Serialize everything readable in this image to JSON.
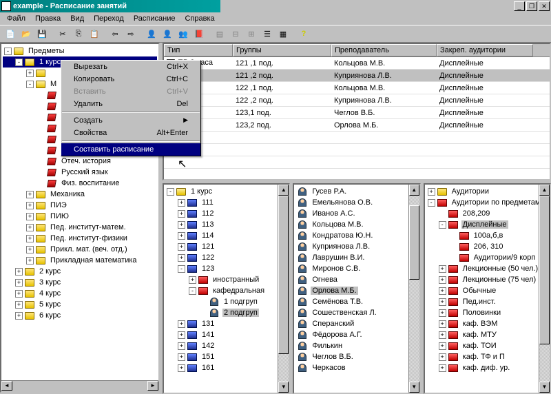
{
  "window": {
    "title": "example - Расписание занятий"
  },
  "menu": [
    "Файл",
    "Правка",
    "Вид",
    "Переход",
    "Расписание",
    "Справка"
  ],
  "ctx": {
    "items": [
      {
        "label": "Вырезать",
        "short": "Ctrl+X",
        "disabled": false
      },
      {
        "label": "Копировать",
        "short": "Ctrl+C",
        "disabled": false
      },
      {
        "label": "Вставить",
        "short": "Ctrl+V",
        "disabled": true
      },
      {
        "label": "Удалить",
        "short": "Del",
        "disabled": false
      },
      {
        "sep": true
      },
      {
        "label": "Создать",
        "submenu": true,
        "disabled": false
      },
      {
        "label": "Свойства",
        "short": "Alt+Enter",
        "disabled": false
      },
      {
        "sep": true
      },
      {
        "label": "Составить расписание",
        "highlight": true,
        "disabled": false
      }
    ]
  },
  "left_tree": [
    {
      "d": 0,
      "exp": "-",
      "ico": "folder-open",
      "t": "Предметы"
    },
    {
      "d": 1,
      "exp": "-",
      "ico": "folder-open",
      "t": "1 курс",
      "sel": true
    },
    {
      "d": 2,
      "exp": "+",
      "ico": "folder-closed",
      "t": ""
    },
    {
      "d": 2,
      "exp": "-",
      "ico": "folder-open",
      "t": "М"
    },
    {
      "d": 3,
      "exp": "",
      "ico": "book",
      "t": ""
    },
    {
      "d": 3,
      "exp": "",
      "ico": "book",
      "t": ""
    },
    {
      "d": 3,
      "exp": "",
      "ico": "book",
      "t": ""
    },
    {
      "d": 3,
      "exp": "",
      "ico": "book",
      "t": ""
    },
    {
      "d": 3,
      "exp": "",
      "ico": "book",
      "t": ""
    },
    {
      "d": 3,
      "exp": "",
      "ico": "book",
      "t": ""
    },
    {
      "d": 3,
      "exp": "",
      "ico": "book",
      "t": "Отеч. история"
    },
    {
      "d": 3,
      "exp": "",
      "ico": "book",
      "t": "Русский язык"
    },
    {
      "d": 3,
      "exp": "",
      "ico": "book",
      "t": "Физ. воспитание"
    },
    {
      "d": 2,
      "exp": "+",
      "ico": "folder-closed",
      "t": "Механика"
    },
    {
      "d": 2,
      "exp": "+",
      "ico": "folder-closed",
      "t": "ПИЭ"
    },
    {
      "d": 2,
      "exp": "+",
      "ico": "folder-closed",
      "t": "ПИЮ"
    },
    {
      "d": 2,
      "exp": "+",
      "ico": "folder-closed",
      "t": "Пед. институт-матем."
    },
    {
      "d": 2,
      "exp": "+",
      "ico": "folder-closed",
      "t": "Пед. институт-физики"
    },
    {
      "d": 2,
      "exp": "+",
      "ico": "folder-closed",
      "t": "Прикл. мат. (веч. отд.)"
    },
    {
      "d": 2,
      "exp": "+",
      "ico": "folder-closed",
      "t": "Прикладная математика"
    },
    {
      "d": 1,
      "exp": "+",
      "ico": "folder-closed",
      "t": "2 курс"
    },
    {
      "d": 1,
      "exp": "+",
      "ico": "folder-closed",
      "t": "3 курс"
    },
    {
      "d": 1,
      "exp": "+",
      "ico": "folder-closed",
      "t": "4 курс"
    },
    {
      "d": 1,
      "exp": "+",
      "ico": "folder-closed",
      "t": "5 курс"
    },
    {
      "d": 1,
      "exp": "+",
      "ico": "folder-closed",
      "t": "6 курс"
    }
  ],
  "grid": {
    "headers": {
      "type": "Тип",
      "group": "Группы",
      "teacher": "Преподаватель",
      "room": "Закреп. аудитории"
    },
    "rows": [
      {
        "type_checkbox": true,
        "type": "ПР   2 часа",
        "group": "121 ,1 под.",
        "teacher": "Кольцова М.В.",
        "room": "Дисплейные"
      },
      {
        "type": "",
        "group": "121 ,2 под.",
        "teacher": "Куприянова Л.В.",
        "room": "Дисплейные",
        "hl": true
      },
      {
        "type": "",
        "group": "122 ,1 под.",
        "teacher": "Кольцова М.В.",
        "room": "Дисплейные"
      },
      {
        "type": "",
        "group": "122 ,2 под.",
        "teacher": "Куприянова Л.В.",
        "room": "Дисплейные"
      },
      {
        "type": "",
        "group": "123,1 под.",
        "teacher": "Чеглов В.Б.",
        "room": "Дисплейные"
      },
      {
        "type": "",
        "group": "123,2 под.",
        "teacher": "Орлова М.Б.",
        "room": "Дисплейные"
      }
    ]
  },
  "bottom1": [
    {
      "d": 0,
      "exp": "-",
      "ico": "folder-open",
      "t": "1 курс"
    },
    {
      "d": 1,
      "exp": "+",
      "ico": "folder-blue",
      "t": "111"
    },
    {
      "d": 1,
      "exp": "+",
      "ico": "folder-blue",
      "t": "112"
    },
    {
      "d": 1,
      "exp": "+",
      "ico": "folder-blue",
      "t": "113"
    },
    {
      "d": 1,
      "exp": "+",
      "ico": "folder-blue",
      "t": "114"
    },
    {
      "d": 1,
      "exp": "+",
      "ico": "folder-blue",
      "t": "121"
    },
    {
      "d": 1,
      "exp": "+",
      "ico": "folder-blue",
      "t": "122"
    },
    {
      "d": 1,
      "exp": "-",
      "ico": "folder-blue",
      "t": "123"
    },
    {
      "d": 2,
      "exp": "+",
      "ico": "folder-red",
      "t": "иностранный"
    },
    {
      "d": 2,
      "exp": "-",
      "ico": "folder-red",
      "t": "кафедральная"
    },
    {
      "d": 3,
      "exp": "",
      "ico": "person",
      "t": "1 подгруп"
    },
    {
      "d": 3,
      "exp": "",
      "ico": "person",
      "t": "2 подгруп",
      "gray": true
    },
    {
      "d": 1,
      "exp": "+",
      "ico": "folder-blue",
      "t": "131"
    },
    {
      "d": 1,
      "exp": "+",
      "ico": "folder-blue",
      "t": "141"
    },
    {
      "d": 1,
      "exp": "+",
      "ico": "folder-blue",
      "t": "142"
    },
    {
      "d": 1,
      "exp": "+",
      "ico": "folder-blue",
      "t": "151"
    },
    {
      "d": 1,
      "exp": "+",
      "ico": "folder-blue",
      "t": "161"
    }
  ],
  "bottom2": [
    {
      "ico": "person",
      "t": "Гусев Р.А."
    },
    {
      "ico": "person",
      "t": "Емельянова О.В."
    },
    {
      "ico": "person",
      "t": "Иванов А.С."
    },
    {
      "ico": "person",
      "t": "Кольцова М.В."
    },
    {
      "ico": "person",
      "t": "Кондратова Ю.Н."
    },
    {
      "ico": "person",
      "t": "Куприянова Л.В."
    },
    {
      "ico": "person",
      "t": "Лаврушин В.И."
    },
    {
      "ico": "person",
      "t": "Миронов С.В."
    },
    {
      "ico": "person",
      "t": "Огнева"
    },
    {
      "ico": "person",
      "t": "Орлова М.Б.",
      "gray": true
    },
    {
      "ico": "person",
      "t": "Семёнова Т.В."
    },
    {
      "ico": "person",
      "t": "Сошественская Л."
    },
    {
      "ico": "person",
      "t": "Сперанский"
    },
    {
      "ico": "person",
      "t": "Фёдорова А.Г."
    },
    {
      "ico": "person",
      "t": "Филькин"
    },
    {
      "ico": "person",
      "t": "Чеглов В.Б."
    },
    {
      "ico": "person",
      "t": "Черкасов"
    }
  ],
  "bottom3": [
    {
      "d": 0,
      "exp": "+",
      "ico": "folder-closed",
      "t": "Аудитории"
    },
    {
      "d": 0,
      "exp": "-",
      "ico": "folder-red",
      "t": "Аудитории по предметам"
    },
    {
      "d": 1,
      "exp": "",
      "ico": "folder-red",
      "t": "208,209"
    },
    {
      "d": 1,
      "exp": "-",
      "ico": "folder-red",
      "t": "Дисплейные",
      "gray": true
    },
    {
      "d": 2,
      "exp": "",
      "ico": "folder-red",
      "t": "100а,б,в"
    },
    {
      "d": 2,
      "exp": "",
      "ico": "folder-red",
      "t": "206, 310"
    },
    {
      "d": 2,
      "exp": "",
      "ico": "folder-red",
      "t": "Аудитории/9 корп"
    },
    {
      "d": 1,
      "exp": "+",
      "ico": "folder-red",
      "t": "Лекционные (50 чел.)"
    },
    {
      "d": 1,
      "exp": "+",
      "ico": "folder-red",
      "t": "Лекционные (75 чел)"
    },
    {
      "d": 1,
      "exp": "+",
      "ico": "folder-red",
      "t": "Обычные"
    },
    {
      "d": 1,
      "exp": "+",
      "ico": "folder-red",
      "t": "Пед.инст."
    },
    {
      "d": 1,
      "exp": "+",
      "ico": "folder-red",
      "t": "Половинки"
    },
    {
      "d": 1,
      "exp": "+",
      "ico": "folder-red",
      "t": "каф. ВЭМ"
    },
    {
      "d": 1,
      "exp": "+",
      "ico": "folder-red",
      "t": "каф. МТУ"
    },
    {
      "d": 1,
      "exp": "+",
      "ico": "folder-red",
      "t": "каф. ТОИ"
    },
    {
      "d": 1,
      "exp": "+",
      "ico": "folder-red",
      "t": "каф. ТФ и П"
    },
    {
      "d": 1,
      "exp": "+",
      "ico": "folder-red",
      "t": "каф. диф. ур."
    }
  ]
}
